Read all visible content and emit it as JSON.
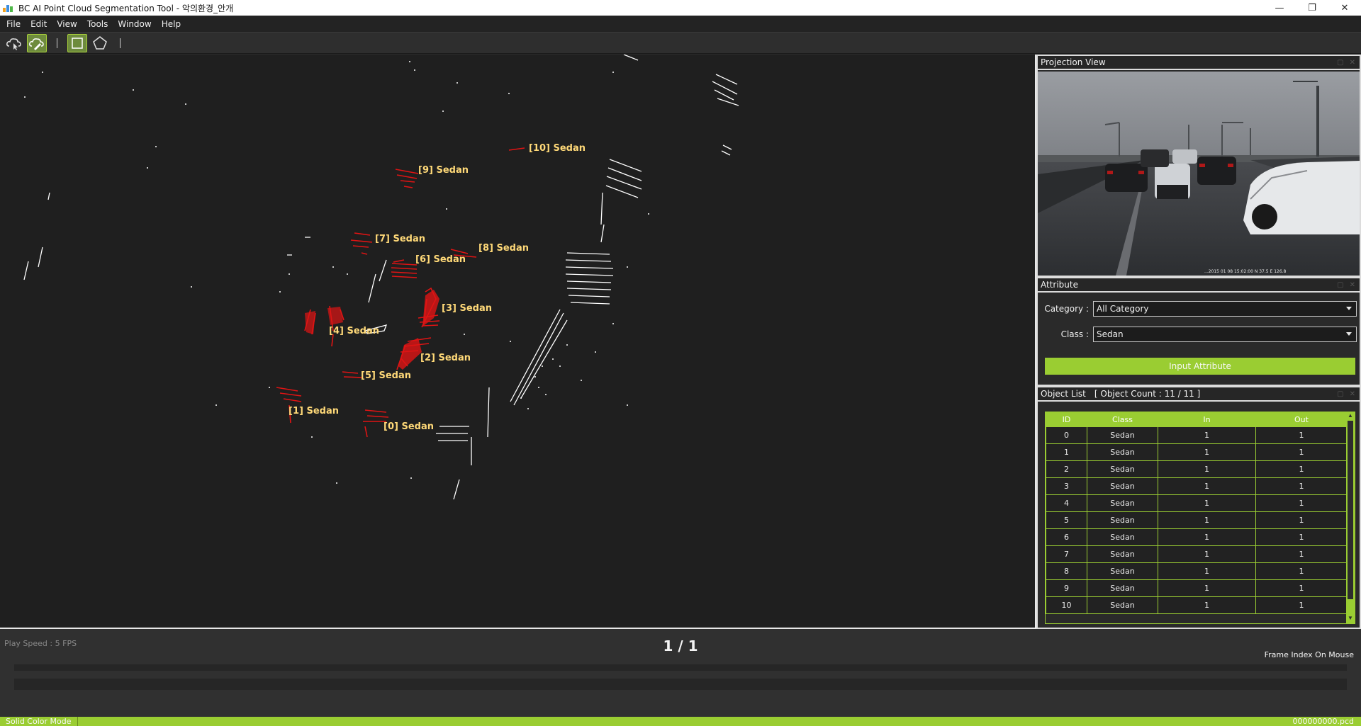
{
  "window": {
    "title": "BC AI Point Cloud Segmentation Tool - 악의환경_안개",
    "minimize": "—",
    "maximize": "❐",
    "close": "✕"
  },
  "menu": [
    "File",
    "Edit",
    "View",
    "Tools",
    "Window",
    "Help"
  ],
  "toolbar": {
    "tools": [
      "cloud-select-icon",
      "cloud-brush-icon",
      "rectangle-select-icon",
      "polygon-select-icon"
    ],
    "active_tools": [
      "cloud-brush-icon",
      "rectangle-select-icon"
    ]
  },
  "viewport": {
    "labels": [
      {
        "text": "[10] Sedan"
      },
      {
        "text": "[9] Sedan"
      },
      {
        "text": "[7] Sedan"
      },
      {
        "text": "[8] Sedan"
      },
      {
        "text": "[6] Sedan"
      },
      {
        "text": "[3] Sedan"
      },
      {
        "text": "[4] Sedan"
      },
      {
        "text": "[2] Sedan"
      },
      {
        "text": "[5] Sedan"
      },
      {
        "text": "[1] Sedan"
      },
      {
        "text": "[0] Sedan"
      }
    ],
    "highlight_color": "#e01414",
    "point_color": "#ffffff"
  },
  "projection": {
    "title": "Projection View",
    "overlay_text": "...2015 01 08 15:02:00 N 37.5 E 126.8"
  },
  "attribute": {
    "title": "Attribute",
    "category_label": "Category :",
    "category_value": "All Category",
    "class_label": "Class :",
    "class_value": "Sedan",
    "input_button": "Input Attribute"
  },
  "object_list": {
    "title": "Object List",
    "count_label": "[ Object Count : 11 / 11 ]",
    "columns": [
      "ID",
      "Class",
      "In",
      "Out"
    ],
    "rows": [
      [
        "0",
        "Sedan",
        "1",
        "1"
      ],
      [
        "1",
        "Sedan",
        "1",
        "1"
      ],
      [
        "2",
        "Sedan",
        "1",
        "1"
      ],
      [
        "3",
        "Sedan",
        "1",
        "1"
      ],
      [
        "4",
        "Sedan",
        "1",
        "1"
      ],
      [
        "5",
        "Sedan",
        "1",
        "1"
      ],
      [
        "6",
        "Sedan",
        "1",
        "1"
      ],
      [
        "7",
        "Sedan",
        "1",
        "1"
      ],
      [
        "8",
        "Sedan",
        "1",
        "1"
      ],
      [
        "9",
        "Sedan",
        "1",
        "1"
      ],
      [
        "10",
        "Sedan",
        "1",
        "1"
      ]
    ]
  },
  "playback": {
    "play_speed": "Play Speed : 5 FPS",
    "frame_counter": "1 / 1",
    "frame_index_mode": "Frame Index On Mouse"
  },
  "status": {
    "mode": "Solid Color Mode",
    "file": "000000000.pcd"
  },
  "colors": {
    "accent": "#9acd32",
    "background": "#2b2b2b",
    "label": "#ffd978"
  }
}
